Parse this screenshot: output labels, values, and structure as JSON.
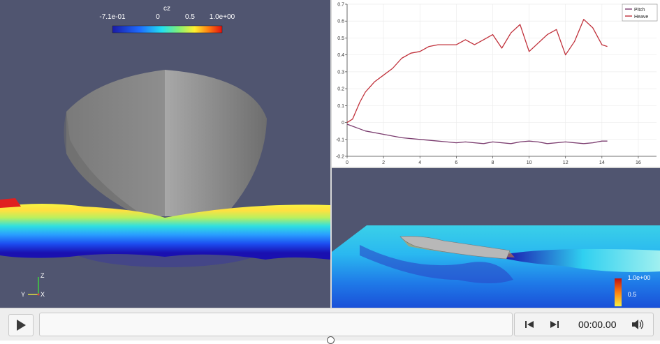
{
  "left_view": {
    "colorbar": {
      "title": "cz",
      "tick_labels": [
        "-7.1e-01",
        "0",
        "0.5",
        "1.0e+00"
      ]
    },
    "axes_triad": {
      "z": "Z",
      "y": "Y",
      "x": "X"
    }
  },
  "chart": {
    "legend": [
      "Pitch",
      "Heave"
    ],
    "colors": {
      "pitch": "#7a3b6e",
      "heave": "#c0303a"
    }
  },
  "chart_data": {
    "type": "line",
    "xlim": [
      0,
      17
    ],
    "ylim": [
      -0.2,
      0.7
    ],
    "x_ticks": [
      "0",
      "2",
      "4",
      "6",
      "8",
      "10",
      "12",
      "14",
      "16"
    ],
    "y_ticks": [
      "-0.2",
      "-0.1",
      "0",
      "0.1",
      "0.2",
      "0.3",
      "0.4",
      "0.5",
      "0.6",
      "0.7"
    ],
    "series": [
      {
        "name": "Pitch",
        "x": [
          0,
          0.5,
          1,
          2,
          3,
          4,
          5,
          6,
          6.5,
          7,
          7.5,
          8,
          8.5,
          9,
          9.5,
          10,
          10.5,
          11,
          11.5,
          12,
          12.5,
          13,
          13.5,
          14,
          14.3
        ],
        "y": [
          -0.01,
          -0.03,
          -0.05,
          -0.07,
          -0.09,
          -0.1,
          -0.11,
          -0.12,
          -0.115,
          -0.12,
          -0.125,
          -0.115,
          -0.12,
          -0.125,
          -0.115,
          -0.11,
          -0.115,
          -0.125,
          -0.12,
          -0.115,
          -0.12,
          -0.125,
          -0.12,
          -0.11,
          -0.11
        ]
      },
      {
        "name": "Heave",
        "x": [
          0,
          0.3,
          0.7,
          1,
          1.5,
          2,
          2.5,
          3,
          3.5,
          4,
          4.5,
          5,
          5.5,
          6,
          6.5,
          7,
          7.5,
          8,
          8.5,
          9,
          9.5,
          10,
          10.5,
          11,
          11.5,
          12,
          12.5,
          13,
          13.5,
          14,
          14.3
        ],
        "y": [
          0,
          0.02,
          0.12,
          0.18,
          0.24,
          0.28,
          0.32,
          0.38,
          0.41,
          0.42,
          0.45,
          0.46,
          0.46,
          0.46,
          0.49,
          0.46,
          0.49,
          0.52,
          0.44,
          0.53,
          0.58,
          0.42,
          0.47,
          0.52,
          0.55,
          0.4,
          0.48,
          0.61,
          0.56,
          0.46,
          0.45
        ]
      }
    ]
  },
  "bottom_view": {
    "colorbar_labels": [
      "1.0e+00",
      "0.5"
    ]
  },
  "player": {
    "play_icon": "play-icon",
    "prev_icon": "skip-back-icon",
    "next_icon": "skip-forward-icon",
    "volume_icon": "volume-icon",
    "time": "00:00.00"
  }
}
